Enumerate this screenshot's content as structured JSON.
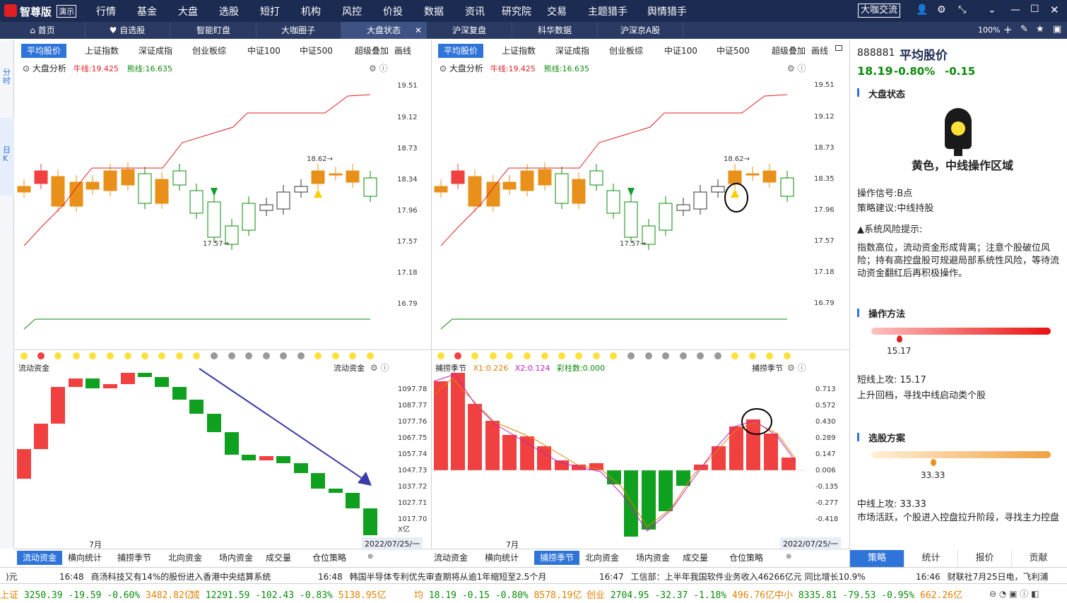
{
  "app": {
    "logo": "智尊版",
    "logo_badge": "演示"
  },
  "menu": [
    "行情",
    "基金",
    "大盘",
    "选股",
    "短打",
    "机构",
    "风控",
    "价投",
    "数据",
    "资讯",
    "研究院",
    "交易",
    "主题猎手",
    "舆情猎手"
  ],
  "top_button": "大咖交流",
  "tabs": [
    {
      "label": "首页",
      "icon": "home-icon"
    },
    {
      "label": "自选股",
      "icon": "heart-icon"
    },
    {
      "label": "智能盯盘"
    },
    {
      "label": "大咖圈子"
    },
    {
      "label": "大盘状态",
      "active": true
    },
    {
      "label": "沪深复盘"
    },
    {
      "label": "科华数据"
    },
    {
      "label": "沪深京A股"
    }
  ],
  "zoom": "100%",
  "left_tools": [
    "分时",
    "日K"
  ],
  "indicator_tabs_left": [
    "平均股价",
    "上证指数",
    "深证成指",
    "创业板综",
    "中证100",
    "中证500",
    "超级叠加",
    "画线"
  ],
  "indicator_tabs_right": [
    "平均股价",
    "上证指数",
    "深证成指",
    "创业板综",
    "中证100",
    "中证500",
    "超级叠加",
    "画线"
  ],
  "chart_header": {
    "name": "大盘分析",
    "bull_label": "牛线:19.425",
    "bear_label": "熊线:16.635"
  },
  "price_axis": [
    "19.51",
    "19.12",
    "18.73",
    "18.34",
    "17.96",
    "17.57",
    "17.18",
    "16.79"
  ],
  "price_axis_right": [
    "19.51",
    "19.12",
    "18.73",
    "18.35",
    "17.96",
    "17.57",
    "17.18",
    "16.79"
  ],
  "annotations": {
    "high": "18.62",
    "low": "17.57"
  },
  "flow_title": "流动资金",
  "flow_axis": [
    "1097.78",
    "1087.77",
    "1077.76",
    "1067.75",
    "1057.74",
    "1047.73",
    "1037.72",
    "1027.71",
    "1017.70",
    "X亿"
  ],
  "season_header": {
    "title": "捕捞季节",
    "x1": "X1:0.226",
    "x2": "X2:0.124",
    "caishu": "彩柱数:0.000"
  },
  "season_axis": [
    "0.713",
    "0.572",
    "0.430",
    "0.289",
    "0.147",
    "0.006",
    "-0.135",
    "-0.277",
    "-0.418"
  ],
  "date_month": "7月",
  "date_label": "2022/07/25/一",
  "bottom_tabs_left": [
    "流动资金",
    "横向统计",
    "捕捞季节",
    "北向资金",
    "场内资金",
    "成交量",
    "仓位策略"
  ],
  "bottom_tabs_right": [
    "流动资金",
    "横向统计",
    "捕捞季节",
    "北向资金",
    "场内资金",
    "成交量",
    "仓位策略"
  ],
  "side": {
    "code": "888881",
    "name": "平均股价",
    "price": "18.19",
    "pct": "-0.80%",
    "chg": "-0.15",
    "status_title": "大盘状态",
    "light_text": "黄色，中线操作区域",
    "signal": "操作信号:B点",
    "advice": "策略建议:中线持股",
    "risk_title": "▲系统风险提示:",
    "risk_text": "指数高位，流动资金形成背离；注意个股破位风险；持有高控盘股可规避局部系统性风险，等待流动资金翻红后再积极操作。",
    "method_title": "操作方法",
    "method_value": "15.17",
    "method_line1": "短线上攻: 15.17",
    "method_line2": "上升回档，寻找中线启动类个股",
    "pick_title": "选股方案",
    "pick_value": "33.33",
    "pick_line1": "中线上攻: 33.33",
    "pick_line2": "市场活跃，个股进入控盘拉升阶段，寻找主力控盘",
    "tabs": [
      "策略",
      "统计",
      "报价",
      "贡献"
    ]
  },
  "news": [
    {
      "time": "16:48",
      "text": "商汤科技又有14%的股份进入香港中央结算系统"
    },
    {
      "time": "16:48",
      "text": "韩国半导体专利优先审查期将从逾1年缩短至2.5个月"
    },
    {
      "time": "16:47",
      "text": "工信部：上半年我国软件业务收入46266亿元 同比增长10.9%"
    },
    {
      "time": "16:46",
      "text": "财联社7月25日电，飞利浦"
    }
  ],
  "ticker": {
    "sh": "3250.39 -19.59 -0.60%",
    "sh_amt": "3482.82亿",
    "sz_label": "成",
    "sz": "12291.59 -102.43 -0.83%",
    "sz_amt": "5138.95亿",
    "avg_label": "均",
    "avg": "18.19 -0.15 -0.80%",
    "avg_amt": "8578.19亿",
    "cy_label": "创业",
    "cy": "2704.95 -32.37 -1.18%",
    "cy_amt": "496.76亿",
    "zx_label": "中小",
    "zx": "8335.81 -79.53 -0.95%",
    "zx_amt": "662.26亿"
  },
  "colors": {
    "up": "#e02020",
    "down": "#0a8a0a",
    "candle_orange": "#e8901a",
    "flow_red": "#f04040",
    "flow_green": "#10a020",
    "accent": "#2f74d8",
    "dark": "#1c2b52"
  }
}
